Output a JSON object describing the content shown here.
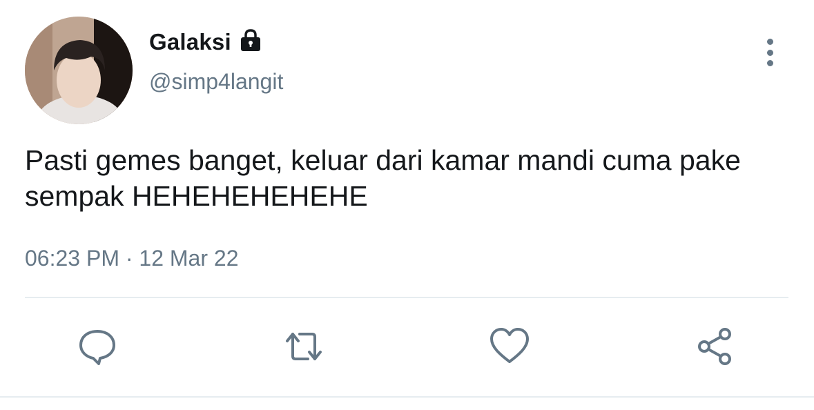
{
  "user": {
    "display_name": "Galaksi",
    "handle": "@simp4langit",
    "protected": true
  },
  "tweet": {
    "text": "Pasti gemes banget, keluar dari kamar mandi cuma pake sempak HEHEHEHEHEHE",
    "time": "06:23 PM",
    "separator": "·",
    "date": "12 Mar 22"
  },
  "icons": {
    "lock": "lock-icon",
    "more": "vertical-dots-icon",
    "reply": "reply-bubble-icon",
    "retweet": "retweet-icon",
    "like": "heart-icon",
    "share": "share-icon"
  },
  "colors": {
    "text_primary": "#14171a",
    "text_secondary": "#657786",
    "divider": "#e6ecf0"
  }
}
